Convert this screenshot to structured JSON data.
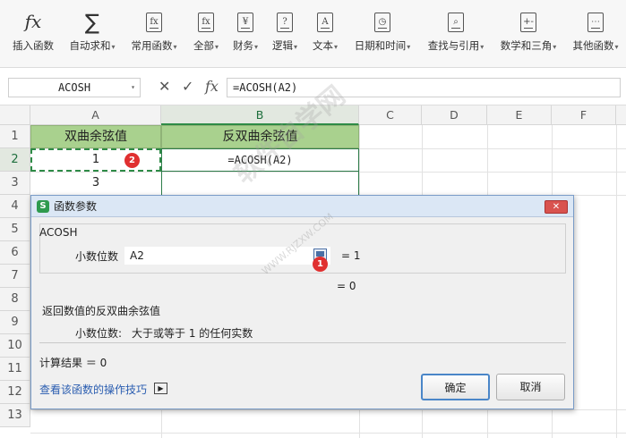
{
  "ribbon": {
    "items": [
      {
        "label": "插入函数",
        "icon": "fx-icon",
        "dropdown": false
      },
      {
        "label": "自动求和",
        "icon": "sigma-icon",
        "dropdown": true
      },
      {
        "label": "常用函数",
        "icon": "fx-star-icon",
        "dropdown": true
      },
      {
        "label": "全部",
        "icon": "fx-doc-icon",
        "dropdown": true
      },
      {
        "label": "财务",
        "icon": "yen-doc-icon",
        "dropdown": true
      },
      {
        "label": "逻辑",
        "icon": "question-doc-icon",
        "dropdown": true
      },
      {
        "label": "文本",
        "icon": "text-doc-icon",
        "dropdown": true
      },
      {
        "label": "日期和时间",
        "icon": "clock-doc-icon",
        "dropdown": true
      },
      {
        "label": "查找与引用",
        "icon": "search-doc-icon",
        "dropdown": true
      },
      {
        "label": "数学和三角",
        "icon": "math-doc-icon",
        "dropdown": true
      },
      {
        "label": "其他函数",
        "icon": "more-doc-icon",
        "dropdown": true
      }
    ],
    "icon_glyphs": {
      "fx": "fx",
      "sigma": "∑",
      "star": "fx",
      "all": "fx",
      "yen": "¥",
      "logic": "?",
      "text": "A",
      "clock": "◷",
      "search": "⌕",
      "math": "+-",
      "more": "⋯"
    }
  },
  "formula_bar": {
    "name_box": "ACOSH",
    "cancel": "✕",
    "confirm": "✓",
    "fx": "fx",
    "formula": "=ACOSH(A2)"
  },
  "grid": {
    "columns": [
      "A",
      "B",
      "C",
      "D",
      "E",
      "F"
    ],
    "rows": [
      "1",
      "2",
      "3",
      "4",
      "5",
      "6",
      "7",
      "8",
      "9",
      "10",
      "11",
      "12",
      "13"
    ],
    "A1": "双曲余弦值",
    "B1": "反双曲余弦值",
    "A2": "1",
    "B2": "=ACOSH(A2)",
    "A3": "3"
  },
  "dialog": {
    "title": "函数参数",
    "function_name": "ACOSH",
    "arg_label": "小数位数",
    "arg_value": "A2",
    "arg_result": "= 1",
    "func_result": "= 0",
    "description": "返回数值的反双曲余弦值",
    "arg_desc_label": "小数位数:",
    "arg_desc": "大于或等于 1 的任何实数",
    "calc_result": "计算结果 ＝ 0",
    "help_link": "查看该函数的操作技巧",
    "ok": "确定",
    "cancel": "取消",
    "close": "✕"
  },
  "badges": {
    "one": "1",
    "two": "2"
  },
  "colors": {
    "header_fill": "#a9d18e",
    "selection": "#2e8b46",
    "badge": "#e03030"
  },
  "watermark": {
    "main": "软件自学网",
    "sub": "WWW.RJZXW.COM"
  }
}
